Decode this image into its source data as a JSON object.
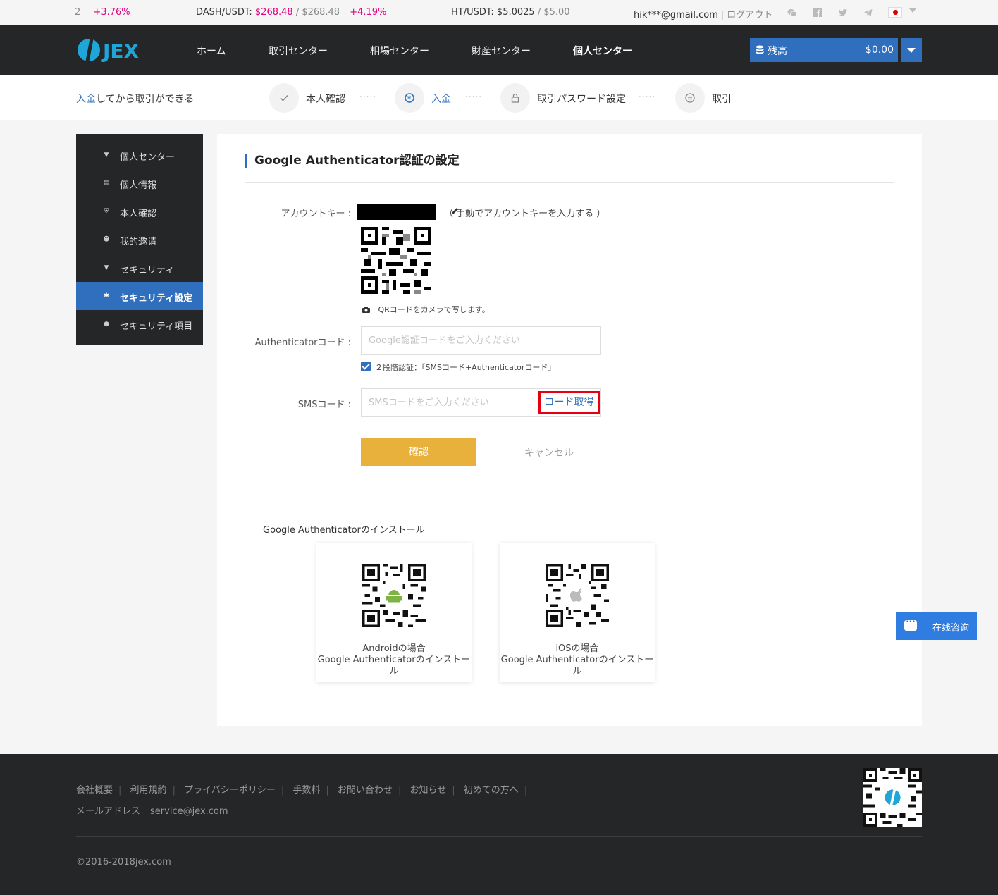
{
  "ticker": {
    "items": [
      {
        "pair": "2",
        "price": "",
        "ref": "",
        "change": "+3.76%"
      },
      {
        "pair": "DASH/USDT:",
        "price": "$268.48",
        "ref": "/ $268.48",
        "change": "+4.19%"
      },
      {
        "pair": "HT/USDT:",
        "price": "$5.0025",
        "ref": "/ $5.00",
        "change": ""
      }
    ],
    "email": "hik***@gmail.com",
    "logout": "ログアウト",
    "social_icons": [
      "wechat-icon",
      "facebook-icon",
      "twitter-icon",
      "telegram-icon"
    ],
    "language_flag": "japan-flag-icon"
  },
  "header": {
    "logo_text": "JEX",
    "nav": [
      "ホーム",
      "取引センター",
      "相場センター",
      "財産センター",
      "個人センター"
    ],
    "active_nav": "個人センター",
    "balance_label": "残高",
    "balance_value": "$0.00"
  },
  "steps": {
    "hint_link": "入金",
    "hint_rest": "してから取引ができる",
    "items": [
      {
        "label": "本人確認",
        "icon": "check-icon"
      },
      {
        "label": "入金",
        "icon": "deposit-icon"
      },
      {
        "label": "取引パスワード設定",
        "icon": "lock-icon"
      },
      {
        "label": "取引",
        "icon": "trade-icon"
      }
    ],
    "dots": "·····"
  },
  "sidebar": {
    "items": [
      {
        "label": "個人センター",
        "icon": "caret-down-icon"
      },
      {
        "label": "個人情報",
        "icon": "document-icon"
      },
      {
        "label": "本人確認",
        "icon": "shield-icon"
      },
      {
        "label": "我的邀请",
        "icon": "user-icon"
      },
      {
        "label": "セキュリティ",
        "icon": "caret-down-icon"
      },
      {
        "label": "セキュリティ設定",
        "icon": "gear-icon"
      },
      {
        "label": "セキュリティ項目",
        "icon": "bulb-icon"
      }
    ],
    "active": "セキュリティ設定"
  },
  "main": {
    "title": "Google Authenticator認証の設定",
    "account_key_label": "アカウントキー :",
    "manual_key_text": "（ 手動でアカウントキーを入力する ）",
    "qr_note": "QRコードをカメラで写します。",
    "auth_code_label": "Authenticatorコード :",
    "auth_code_placeholder": "Google認証コードをご入力ください",
    "auth_code_value": "",
    "two_step_checked": true,
    "two_step_label": "２段階認証：「SMSコード+Authenticatorコード」",
    "sms_label": "SMSコード :",
    "sms_placeholder": "SMSコードをご入力ください",
    "sms_value": "",
    "get_code": "コード取得",
    "confirm": "確認",
    "cancel": "キャンセル",
    "install_title": "Google Authenticatorのインストール",
    "apps": [
      {
        "line1": "Androidの場合",
        "line2": "Google Authenticatorのインストール",
        "icon": "android-icon"
      },
      {
        "line1": "iOSの場合",
        "line2": "Google Authenticatorのインストール",
        "icon": "apple-icon"
      }
    ]
  },
  "chat": {
    "label": "在线咨询"
  },
  "footer": {
    "links": [
      "会社概要",
      "利用規約",
      "プライバシーポリシー",
      "手数料",
      "お問い合わせ",
      "お知らせ",
      "初めての方へ"
    ],
    "mail_label": "メールアドレス",
    "mail": "service@jex.com",
    "copyright": "©2016-2018jex.com"
  },
  "colors": {
    "accent": "#2f6fbd",
    "confirm": "#e8b13c",
    "positive": "#e5007f",
    "highlight_box": "#e60012",
    "dark": "#252628"
  }
}
